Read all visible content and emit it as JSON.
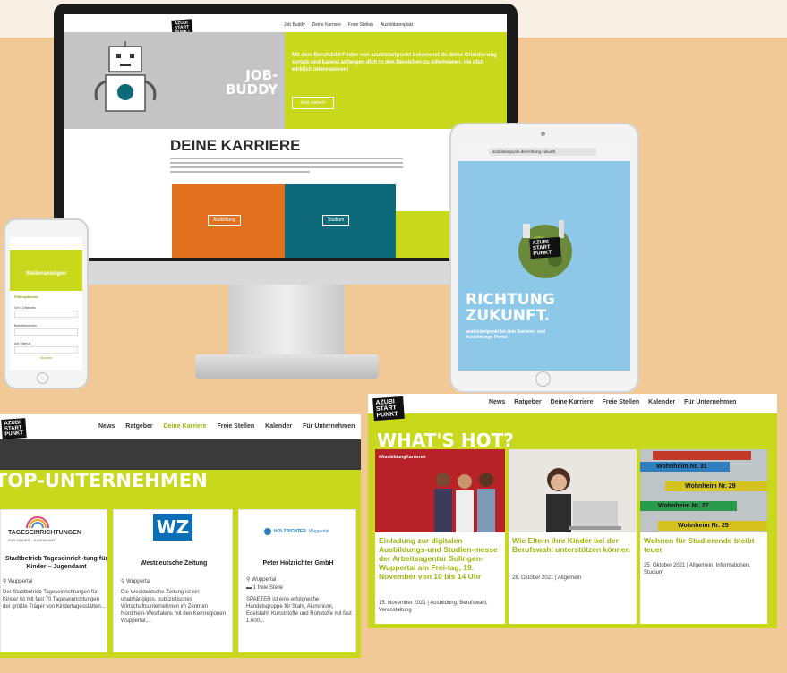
{
  "imac": {
    "nav": [
      "Job Buddy",
      "Deine Karriere",
      "Freie Stellen",
      "Ausbildatenplatz"
    ],
    "hero_title_1": "JOB-",
    "hero_title_2": "BUDDY",
    "hero_text": "Mit dem Berufsbild-Finder von azubistartpunkt bekommst du deine Orientierung zurück und kannst anfangen dich in den Bereichen zu informieren, die dich wirklich interessieren!",
    "hero_button": "Jetzt starten!",
    "section_title": "DEINE KARRIERE",
    "btn_ausbildung": "Ausbildung",
    "btn_studium": "Studium",
    "colors": {
      "lime": "#c8d81d",
      "orange": "#e1711f",
      "teal": "#0e6a78"
    }
  },
  "tablet": {
    "url": "azubistartpunkt.de/richtung-zukunft",
    "headline_1": "RICHTUNG",
    "headline_2": "ZUKUNFT.",
    "subline": "azubistartpunkt ist dein Karriere- und Ausbildungs-Portal.",
    "logo": "AZUBI START PUNKT"
  },
  "phone": {
    "title": "Stellenanzeigen",
    "filter_label": "Filteroptionen",
    "fields": [
      "Ort / Umkreis",
      "Berufsbereich",
      "Art / Beruf"
    ],
    "button": "Suchen"
  },
  "top_panel": {
    "nav": [
      "News",
      "Ratgeber",
      "Deine Karriere",
      "Freie Stellen",
      "Kalender",
      "Für Unternehmen"
    ],
    "title": "TOP-UNTERNEHMEN",
    "cards": [
      {
        "logo_text": "TAGESEINRICHTUNGEN",
        "logo_sub": "FÜR KINDER - JUGENDAMT",
        "name": "Stadtbetrieb Tageseinrich-tung für Kinder – Jugendamt",
        "place": "Wuppertal",
        "jobs": "",
        "text": "Der Stadtbetrieb Tageseinrichtungen für Kinder ist mit fast 70 Tageseinrichtungen der größte Träger von Kindertagesstätten..."
      },
      {
        "logo_text": "WZ",
        "logo_sub": "",
        "name": "Westdeutsche Zeitung",
        "place": "Wuppertal",
        "jobs": "",
        "text": "Die Westdeutsche Zeitung ist ein unabhängiges, publizistisches Wirtschaftsunternehmen im Zentrum Nordrhein-Westfalens mit den Kernregionen Wuppertal,..."
      },
      {
        "logo_text": "HOLZRICHTER",
        "logo_sub": "Wuppertal",
        "name": "Peter Holzrichter GmbH",
        "place": "Wuppertal",
        "jobs": "1 freie Stelle",
        "text": "SPAETER ist eine erfolgreiche Handelsgruppe für Stahl, Aluminium, Edelstahl, Kunststoffe und Rohstoffe mit fast 1.600..."
      }
    ]
  },
  "hot_panel": {
    "nav": [
      "News",
      "Ratgeber",
      "Deine Karriere",
      "Freie Stellen",
      "Kalender",
      "Für Unternehmen"
    ],
    "title": "WHAT'S HOT?",
    "logo": "AZUBI START PUNKT",
    "articles": [
      {
        "title": "Einladung zur digitalen Ausbildungs-und Studien-messe der Arbeitsagentur Solingen-Wuppertal am Frei-tag, 19. November von 10 bis 14 Uhr",
        "meta": "15. November 2021 | Ausbildung, Berufswahl, Veranstaltung",
        "img_caption": "#AusbildungKarrieren"
      },
      {
        "title": "Wie Eltern ihre Kinder bei der Berufswahl unterstützen können",
        "meta": "28. Oktober 2021 | Allgemein",
        "img_caption": ""
      },
      {
        "title": "Wohnen für Studierende bleibt teuer",
        "meta": "25. Oktober 2021 | Allgemein, Informationen, Studium",
        "img_caption": ""
      }
    ],
    "signs": [
      "Wohnheim Nr. 31",
      "Wohnheim Nr. 29",
      "Wohnheim Nr. 27",
      "Wohnheim Nr. 25"
    ]
  }
}
